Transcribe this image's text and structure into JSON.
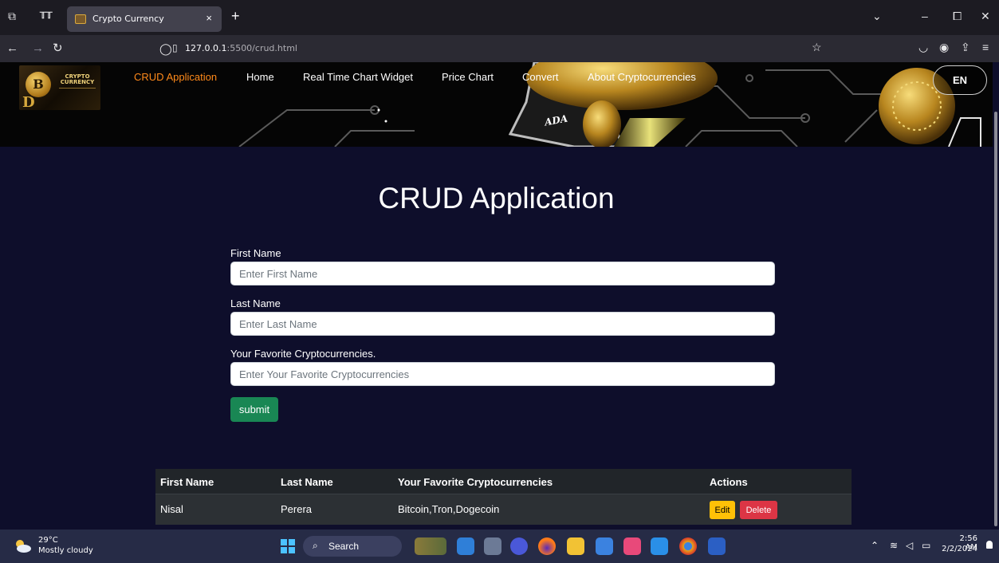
{
  "browser": {
    "tab_title": "Crypto Currency",
    "tab_close": "×",
    "new_tab": "+",
    "url_host": "127.0.0.1",
    "url_rest": ":5500/crud.html"
  },
  "header": {
    "logo_line1": "CRYPTO",
    "logo_line2": "CURRENCY",
    "logo_b": "B",
    "logo_d": "D",
    "art_text": "ADA",
    "menu": [
      "CRUD Application",
      "Home",
      "Real Time Chart Widget",
      "Price Chart",
      "Convert",
      "About Cryptocurrencies"
    ],
    "lang": "EN"
  },
  "main": {
    "title": "CRUD Application",
    "form": {
      "first_name_label": "First Name",
      "first_name_placeholder": "Enter First Name",
      "last_name_label": "Last Name",
      "last_name_placeholder": "Enter Last Name",
      "crypto_label": "Your Favorite Cryptocurrencies.",
      "crypto_placeholder": "Enter Your Favorite Cryptocurrencies",
      "submit_label": "submit"
    },
    "table": {
      "headers": [
        "First Name",
        "Last Name",
        "Your Favorite Cryptocurrencies",
        "Actions"
      ],
      "rows": [
        {
          "first": "Nisal",
          "last": "Perera",
          "crypto": "Bitcoin,Tron,Dogecoin",
          "edit": "Edit",
          "delete": "Delete"
        }
      ]
    }
  },
  "taskbar": {
    "temperature": "29°C",
    "condition": "Mostly cloudy",
    "search_label": "Search",
    "time": "2:56 AM",
    "date": "2/2/2024"
  },
  "colors": {
    "page_bg": "#0e0e2b",
    "menu_active": "#ff8a1a",
    "submit": "#198754",
    "edit": "#ffc107",
    "delete": "#dc3545",
    "taskbar": "#262b46"
  }
}
